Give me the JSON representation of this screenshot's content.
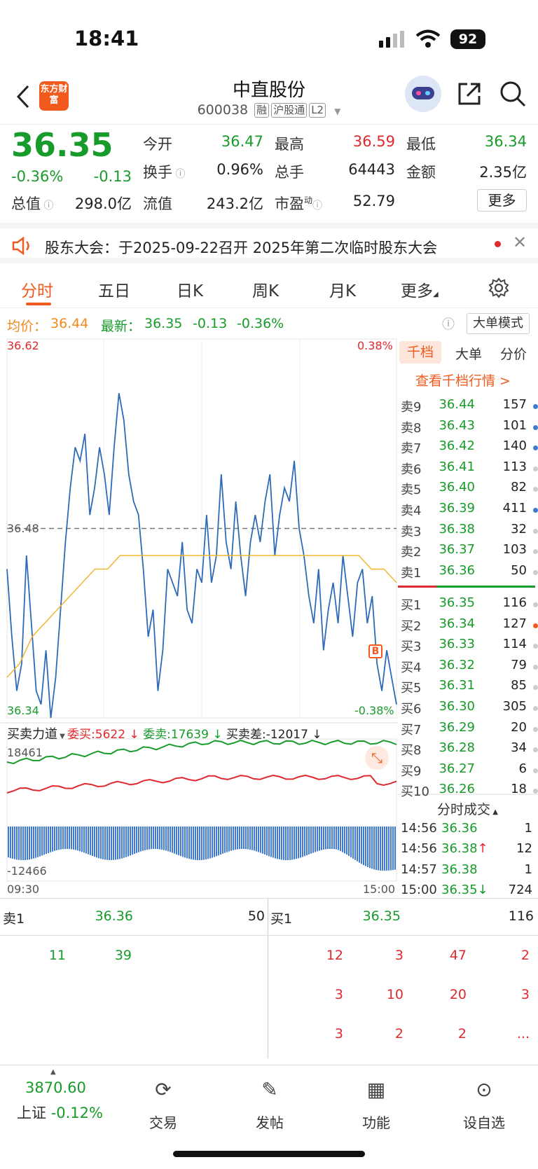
{
  "status_bar": {
    "time": "18:41",
    "battery": "92"
  },
  "header": {
    "logo": "东方财富",
    "title": "中直股份",
    "code": "600038",
    "tags": [
      "融",
      "沪股通",
      "L2"
    ]
  },
  "quote": {
    "price": "36.35",
    "change_pct": "-0.36%",
    "change": "-0.13",
    "fields": [
      {
        "label": "今开",
        "value": "36.47"
      },
      {
        "label": "最高",
        "value": "36.59"
      },
      {
        "label": "最低",
        "value": "36.34"
      },
      {
        "label": "换手",
        "value": "0.96%"
      },
      {
        "label": "总手",
        "value": "64443"
      },
      {
        "label": "金额",
        "value": "2.35亿"
      },
      {
        "label": "总值",
        "value": "298.0亿"
      },
      {
        "label": "流值",
        "value": "243.2亿"
      },
      {
        "label": "市盈",
        "sup": "动",
        "value": "52.79"
      }
    ],
    "more_button": "更多"
  },
  "notice": {
    "text": "股东大会：于2025-09-22召开 2025年第二次临时股东大会"
  },
  "tabs": [
    "分时",
    "五日",
    "日K",
    "周K",
    "月K",
    "更多"
  ],
  "avg_line": {
    "avg_label": "均价：",
    "avg": "36.44",
    "latest_label": "最新：",
    "latest": "36.35",
    "change": "-0.13",
    "change_pct": "-0.36%",
    "big_mode": "大单模式"
  },
  "chart_data": {
    "type": "line",
    "y_max_label": "36.62",
    "y_min_label": "36.34",
    "y_mid_label": "36.48",
    "pct_max_label": "0.38%",
    "pct_min_label": "-0.38%",
    "ylim": [
      36.34,
      36.62
    ],
    "prev_close": 36.48,
    "x_start": "09:30",
    "x_end": "15:00",
    "series": [
      {
        "values": [
          36.45,
          36.4,
          36.36,
          36.38,
          36.46,
          36.41,
          36.36,
          36.35,
          36.39,
          36.34,
          36.37,
          36.42,
          36.47,
          36.51,
          36.54,
          36.53,
          36.55,
          36.49,
          36.51,
          36.54,
          36.52,
          36.49,
          36.54,
          36.58,
          36.56,
          36.52,
          36.5,
          36.49,
          36.45,
          36.4,
          36.42,
          36.36,
          36.39,
          36.45,
          36.44,
          36.43,
          36.47,
          36.42,
          36.41,
          36.45,
          36.44,
          36.49,
          36.44,
          36.46,
          36.52,
          36.47,
          36.45,
          36.5,
          36.46,
          36.43,
          36.47,
          36.49,
          36.47,
          36.5,
          36.52,
          36.46,
          36.49,
          36.51,
          36.5,
          36.53,
          36.48,
          36.46,
          36.43,
          36.41,
          36.45,
          36.39,
          36.42,
          36.44,
          36.41,
          36.46,
          36.43,
          36.4,
          36.44,
          36.45,
          36.41,
          36.43,
          36.38,
          36.36,
          36.39,
          36.37,
          36.35
        ]
      },
      {
        "values": [
          36.37,
          36.38,
          36.4,
          36.41,
          36.42,
          36.43,
          36.44,
          36.45,
          36.45,
          36.46,
          36.46,
          36.46,
          36.46,
          36.46,
          36.46,
          36.46,
          36.46,
          36.46,
          36.46,
          36.46,
          36.46,
          36.46,
          36.46,
          36.46,
          36.46,
          36.46,
          36.46,
          36.46,
          36.46,
          36.45,
          36.45,
          36.44
        ]
      }
    ]
  },
  "vol_header": {
    "title": "买卖力道",
    "buy": "委买:5622",
    "sell": "委卖:17639",
    "diff": "买卖差:-12017",
    "top": "18461",
    "bottom": "-12466"
  },
  "orderbook": {
    "tabs": [
      "千档",
      "大单",
      "分价"
    ],
    "link": "查看千档行情 >",
    "asks": [
      {
        "label": "卖9",
        "price": "36.44",
        "qty": "157"
      },
      {
        "label": "卖8",
        "price": "36.43",
        "qty": "101"
      },
      {
        "label": "卖7",
        "price": "36.42",
        "qty": "140"
      },
      {
        "label": "卖6",
        "price": "36.41",
        "qty": "113"
      },
      {
        "label": "卖5",
        "price": "36.40",
        "qty": "82"
      },
      {
        "label": "卖4",
        "price": "36.39",
        "qty": "411"
      },
      {
        "label": "卖3",
        "price": "36.38",
        "qty": "32"
      },
      {
        "label": "卖2",
        "price": "36.37",
        "qty": "103"
      },
      {
        "label": "卖1",
        "price": "36.36",
        "qty": "50"
      }
    ],
    "bids": [
      {
        "label": "买1",
        "price": "36.35",
        "qty": "116"
      },
      {
        "label": "买2",
        "price": "36.34",
        "qty": "127"
      },
      {
        "label": "买3",
        "price": "36.33",
        "qty": "114"
      },
      {
        "label": "买4",
        "price": "36.32",
        "qty": "79"
      },
      {
        "label": "买5",
        "price": "36.31",
        "qty": "85"
      },
      {
        "label": "买6",
        "price": "36.30",
        "qty": "305"
      },
      {
        "label": "买7",
        "price": "36.29",
        "qty": "20"
      },
      {
        "label": "买8",
        "price": "36.28",
        "qty": "34"
      },
      {
        "label": "买9",
        "price": "36.27",
        "qty": "6"
      },
      {
        "label": "买10",
        "price": "36.26",
        "qty": "18"
      }
    ],
    "trades_title": "分时成交",
    "trades": [
      {
        "time": "14:56",
        "price": "36.36",
        "qty": "1"
      },
      {
        "time": "14:56",
        "price": "36.38↑",
        "qty": "12"
      },
      {
        "time": "14:57",
        "price": "36.38",
        "qty": "1"
      },
      {
        "time": "15:00",
        "price": "36.35↓",
        "qty": "724"
      }
    ]
  },
  "detail": {
    "sell1_label": "卖1",
    "sell1_price": "36.36",
    "sell1_qty": "50",
    "buy1_label": "买1",
    "buy1_price": "36.35",
    "buy1_qty": "116",
    "sell_orders": [
      "11",
      "39"
    ],
    "buy_orders": [
      "12",
      "3",
      "47",
      "2",
      "3",
      "10",
      "20",
      "3",
      "3",
      "2",
      "2",
      "..."
    ]
  },
  "bottom_bar": {
    "index_value": "3870.60",
    "index_name": "上证",
    "index_change": "-0.12%",
    "items": [
      "交易",
      "发帖",
      "功能",
      "设自选"
    ]
  }
}
